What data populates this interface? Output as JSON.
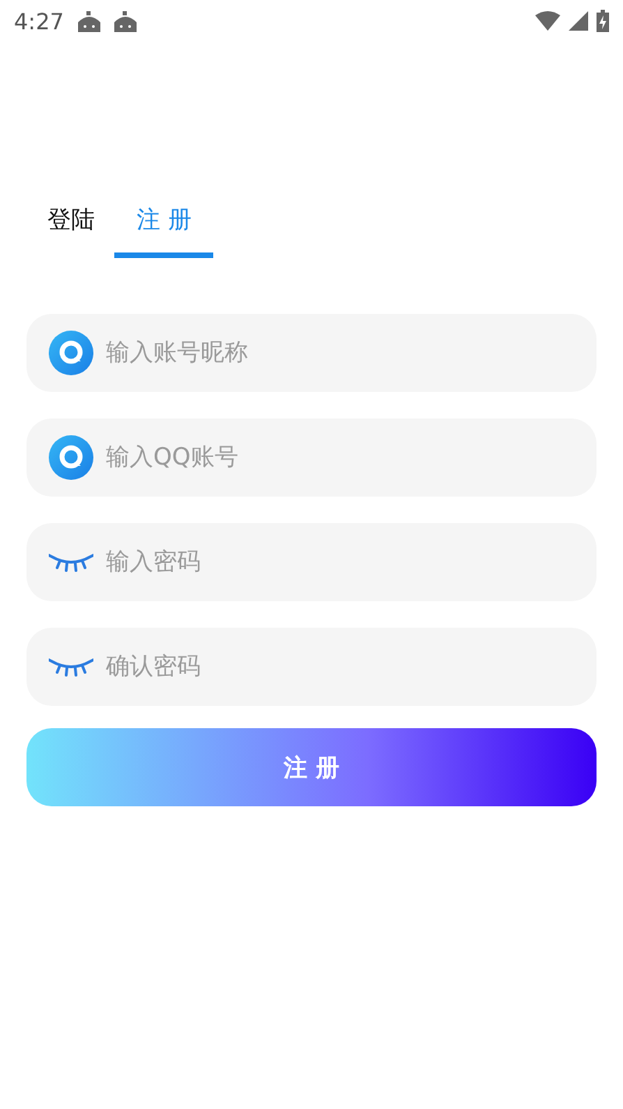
{
  "status_bar": {
    "time": "4:27"
  },
  "tabs": [
    {
      "label": "登陆",
      "selected": false
    },
    {
      "label": "注 册",
      "selected": true
    }
  ],
  "fields": [
    {
      "kind": "account",
      "placeholder": "输入账号昵称"
    },
    {
      "kind": "account",
      "placeholder": "输入QQ账号"
    },
    {
      "kind": "password",
      "placeholder": "输入密码"
    },
    {
      "kind": "password",
      "placeholder": "确认密码"
    }
  ],
  "submit_button": "注 册"
}
